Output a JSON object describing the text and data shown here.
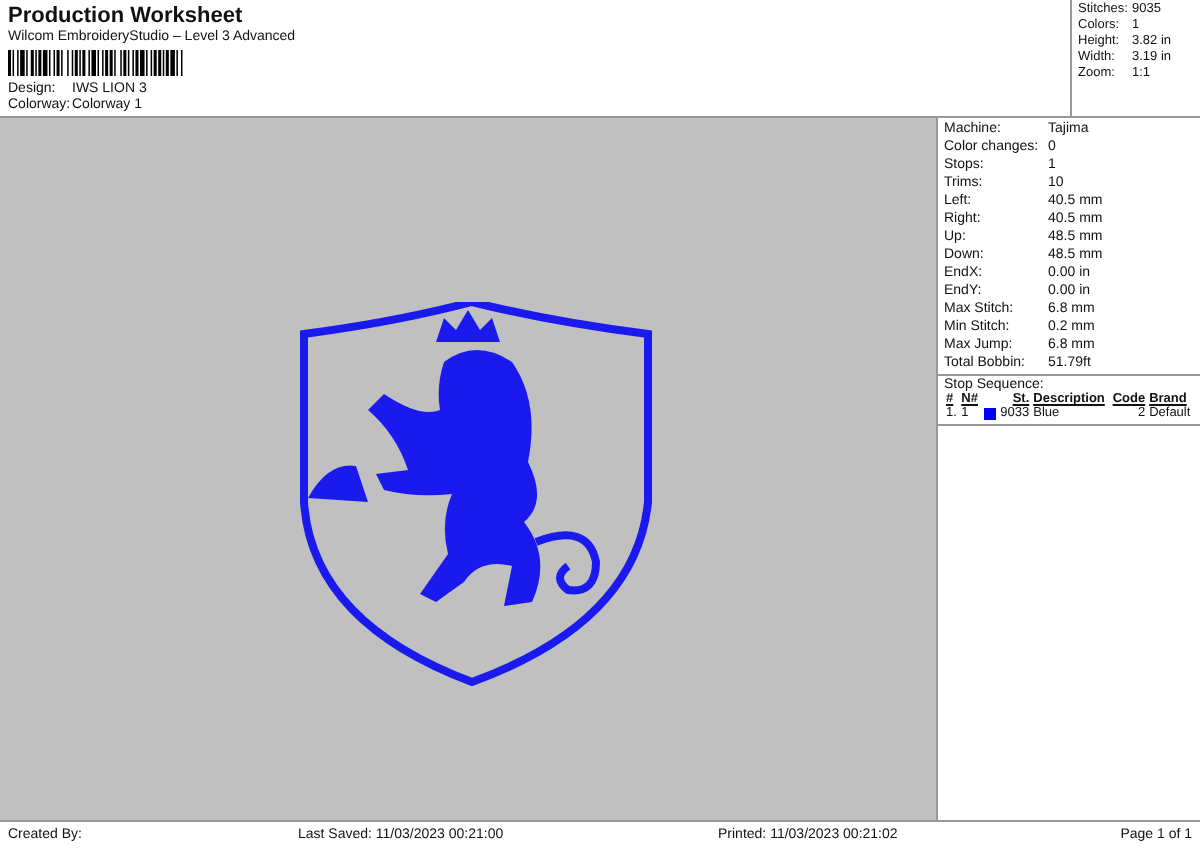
{
  "header": {
    "title": "Production Worksheet",
    "subtitle": "Wilcom EmbroideryStudio – Level 3 Advanced",
    "fields": [
      {
        "label": "Design:",
        "value": "IWS LION 3"
      },
      {
        "label": "Colorway:",
        "value": "Colorway 1"
      }
    ]
  },
  "summary": [
    {
      "label": "Stitches:",
      "value": "9035"
    },
    {
      "label": "Colors:",
      "value": "1"
    },
    {
      "label": "Height:",
      "value": "3.82 in"
    },
    {
      "label": "Width:",
      "value": "3.19 in"
    },
    {
      "label": "Zoom:",
      "value": "1:1"
    }
  ],
  "details": [
    {
      "label": "Machine:",
      "value": "Tajima"
    },
    {
      "label": "Color changes:",
      "value": "0"
    },
    {
      "label": "Stops:",
      "value": "1"
    },
    {
      "label": "Trims:",
      "value": "10"
    },
    {
      "label": "Left:",
      "value": "40.5 mm"
    },
    {
      "label": "Right:",
      "value": "40.5 mm"
    },
    {
      "label": "Up:",
      "value": "48.5 mm"
    },
    {
      "label": "Down:",
      "value": "48.5 mm"
    },
    {
      "label": "EndX:",
      "value": "0.00 in"
    },
    {
      "label": "EndY:",
      "value": "0.00 in"
    },
    {
      "label": "Max Stitch:",
      "value": "6.8 mm"
    },
    {
      "label": "Min Stitch:",
      "value": "0.2 mm"
    },
    {
      "label": "Max Jump:",
      "value": "6.8 mm"
    },
    {
      "label": "Total Bobbin:",
      "value": "51.79ft"
    }
  ],
  "stop_sequence": {
    "title": "Stop Sequence:",
    "columns": [
      "#",
      "N#",
      "St.",
      "Description",
      "Code",
      "Brand"
    ],
    "rows": [
      {
        "number": "1.",
        "needle": "1",
        "color": "#0000ff",
        "stitches": "9033",
        "description": "Blue",
        "code": "2",
        "brand": "Default"
      }
    ]
  },
  "footer": {
    "created_by": "Created By:",
    "last_saved": "Last Saved: 11/03/2023 00:21:00",
    "printed": "Printed: 11/03/2023 00:21:02",
    "page": "Page 1 of 1"
  }
}
